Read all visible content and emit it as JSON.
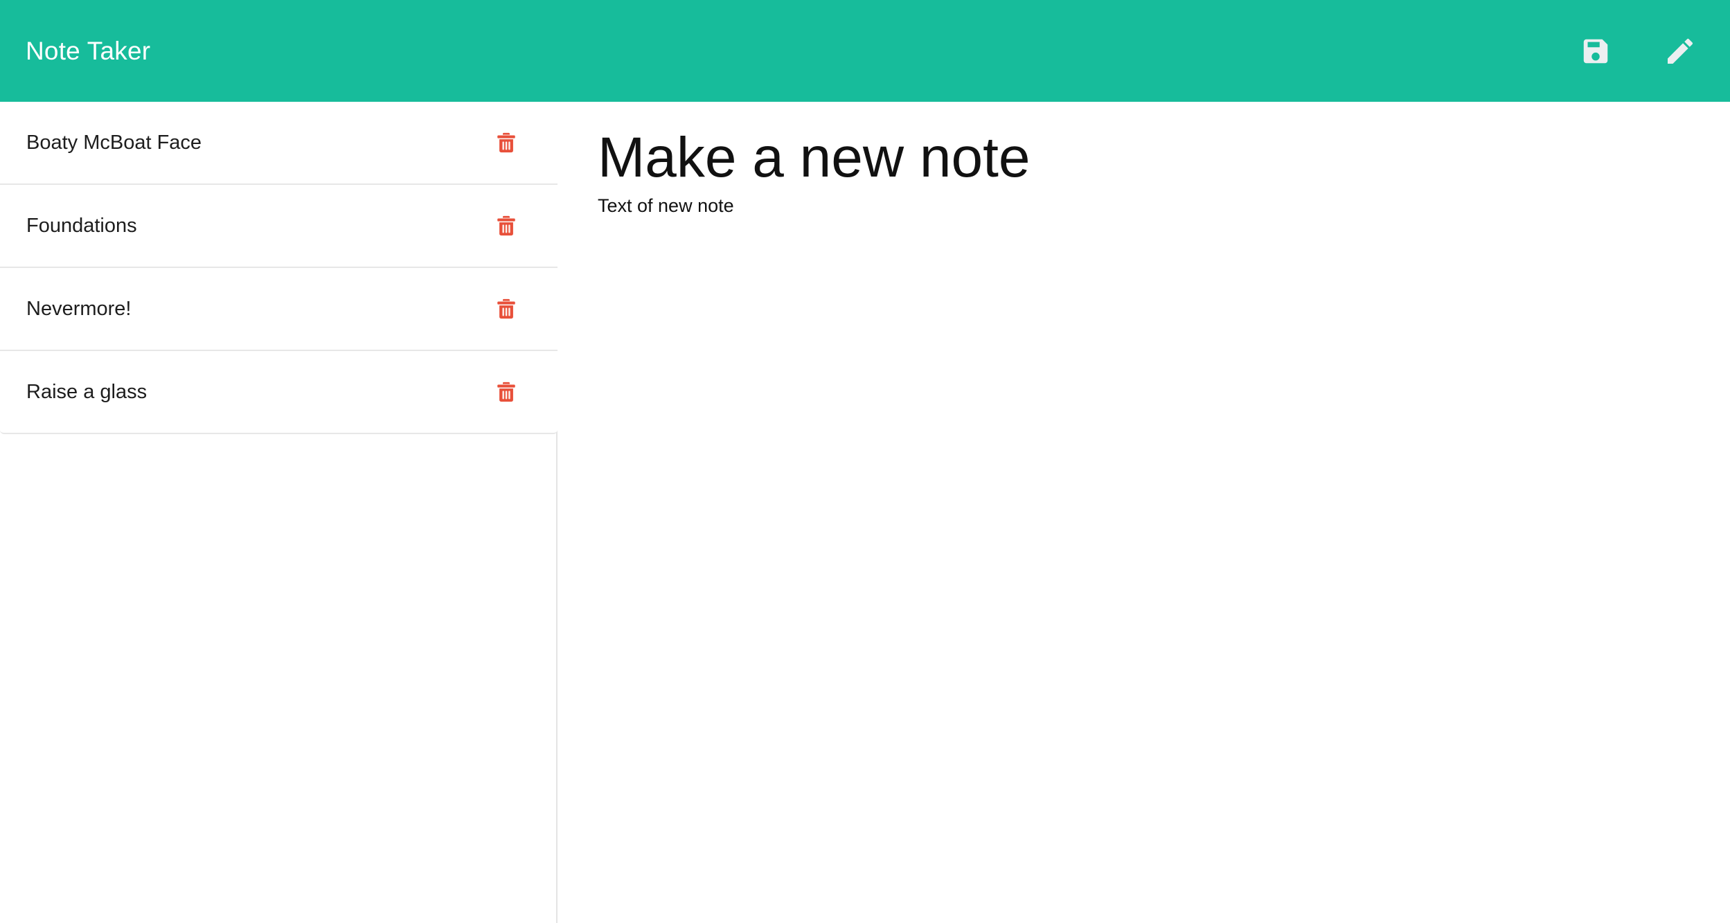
{
  "app": {
    "title": "Note Taker",
    "header_background": "#17bc9b",
    "header_text_color": "#ffffff"
  },
  "header": {
    "actions": [
      {
        "name": "save-note-button",
        "icon": "save-icon",
        "label": "Save"
      },
      {
        "name": "new-note-button",
        "icon": "pencil-icon",
        "label": "New Note"
      }
    ]
  },
  "sidebar": {
    "delete_icon_color": "#e8503a",
    "notes": [
      {
        "title": "Boaty McBoat Face",
        "delete_label": "Delete"
      },
      {
        "title": "Foundations",
        "delete_label": "Delete"
      },
      {
        "title": "Nevermore!",
        "delete_label": "Delete"
      },
      {
        "title": "Raise a glass",
        "delete_label": "Delete"
      }
    ]
  },
  "editor": {
    "title_value": "",
    "title_placeholder": "Make a new note",
    "text_value": "",
    "text_placeholder": "Text of new note"
  }
}
